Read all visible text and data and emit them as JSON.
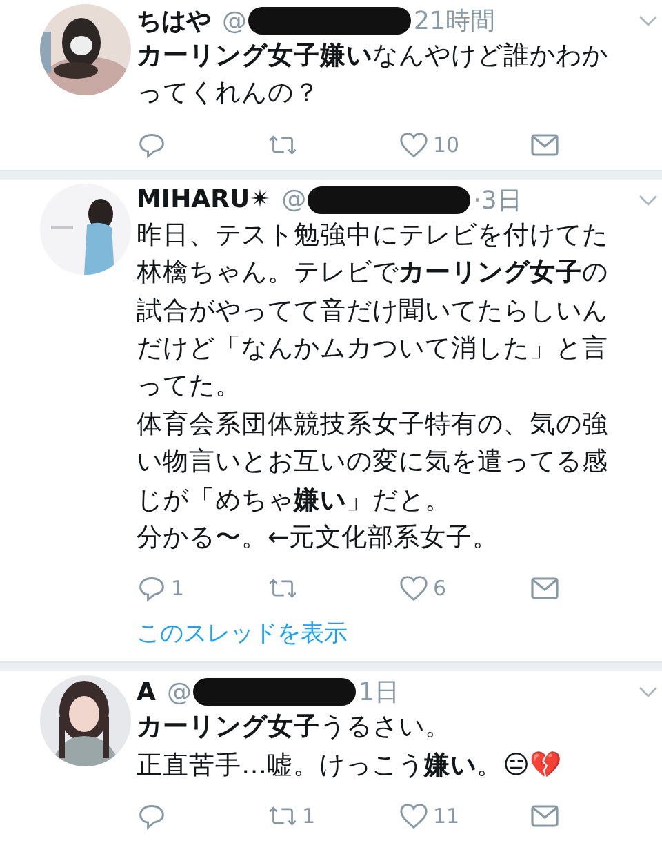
{
  "tweets": [
    {
      "name": "ちはや",
      "handle": "@",
      "handle_redacted": true,
      "time": "21時間",
      "paragraphs": [
        "**カーリング女子嫌い**なんやけど誰かわかってくれんの？"
      ],
      "actions": {
        "like": "10"
      }
    },
    {
      "name": "MIHARU✴",
      "handle": "@",
      "handle_redacted": true,
      "time": "·3日",
      "paragraphs": [
        "昨日、テスト勉強中にテレビを付けてた林檎ちゃん。テレビで**カーリング女子**の試合がやってて音だけ聞いてたらしいんだけど「なんかムカついて消した」と言ってた。",
        "体育会系団体競技系女子特有の、気の強い物言いとお互いの変に気を遣ってる感じが「めちゃ**嫌い**」だと。",
        "分かる〜。←元文化部系女子。"
      ],
      "actions": {
        "reply": "1",
        "like": "6"
      },
      "thread_link": "このスレッドを表示"
    },
    {
      "name": "A",
      "handle": "@",
      "handle_redacted": true,
      "time": "1日",
      "paragraphs": [
        "**カーリング女子**うるさい。",
        "正直苦手…嘘。けっこう**嫌い**。😑💔"
      ],
      "actions": {
        "retweet": "1",
        "like": "11"
      }
    }
  ]
}
